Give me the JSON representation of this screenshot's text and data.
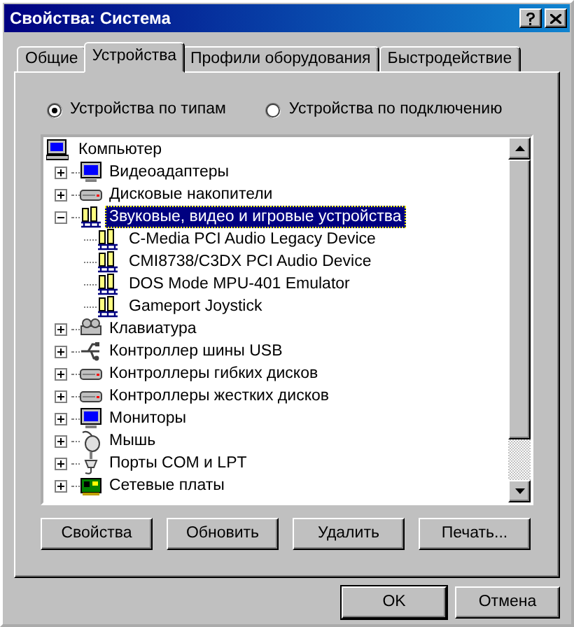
{
  "window": {
    "title": "Свойства: Система"
  },
  "title_buttons": [
    {
      "kind": "help"
    },
    {
      "kind": "close"
    }
  ],
  "tabs": [
    {
      "label": "Общие",
      "selected": false
    },
    {
      "label": "Устройства",
      "selected": true
    },
    {
      "label": "Профили оборудования",
      "selected": false
    },
    {
      "label": "Быстродействие",
      "selected": false
    }
  ],
  "view_options": [
    {
      "label": "Устройства по типам",
      "selected": true
    },
    {
      "label": "Устройства по подключению",
      "selected": false
    }
  ],
  "tree": {
    "label": "Компьютер",
    "kind": "computer",
    "selected": false,
    "children": [
      {
        "label": "Видеоадаптеры",
        "kind": "monitor",
        "expanded": false,
        "selected": false
      },
      {
        "label": "Дисковые накопители",
        "kind": "disk",
        "expanded": false,
        "selected": false
      },
      {
        "label": "Звуковые, видео и игровые устройства",
        "kind": "sound",
        "expanded": true,
        "selected": true,
        "children": [
          {
            "label": "C-Media PCI Audio Legacy Device",
            "kind": "sound",
            "selected": false
          },
          {
            "label": "CMI8738/C3DX PCI Audio Device",
            "kind": "sound",
            "selected": false
          },
          {
            "label": "DOS Mode MPU-401 Emulator",
            "kind": "sound",
            "selected": false
          },
          {
            "label": "Gameport Joystick",
            "kind": "sound",
            "selected": false
          }
        ]
      },
      {
        "label": "Клавиатура",
        "kind": "keyboard",
        "expanded": false,
        "selected": false
      },
      {
        "label": "Контроллер шины USB",
        "kind": "usb",
        "expanded": false,
        "selected": false
      },
      {
        "label": "Контроллеры гибких дисков",
        "kind": "disk",
        "expanded": false,
        "selected": false
      },
      {
        "label": "Контроллеры жестких дисков",
        "kind": "disk",
        "expanded": false,
        "selected": false
      },
      {
        "label": "Мониторы",
        "kind": "monitor",
        "expanded": false,
        "selected": false
      },
      {
        "label": "Мышь",
        "kind": "mouse",
        "expanded": false,
        "selected": false
      },
      {
        "label": "Порты COM и LPT",
        "kind": "port",
        "expanded": false,
        "selected": false
      },
      {
        "label": "Сетевые платы",
        "kind": "network",
        "expanded": false,
        "selected": false
      }
    ]
  },
  "device_buttons": [
    {
      "label": "Свойства"
    },
    {
      "label": "Обновить"
    },
    {
      "label": "Удалить"
    },
    {
      "label": "Печать..."
    }
  ],
  "dialog_buttons": [
    {
      "label": "OK",
      "kind": "default"
    },
    {
      "label": "Отмена",
      "kind": "normal"
    }
  ]
}
